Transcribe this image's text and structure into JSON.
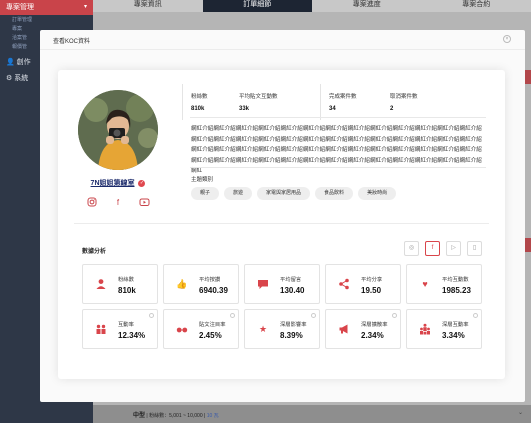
{
  "background": {
    "sidebar": {
      "menu_header": "專案管理",
      "sub_items": [
        "訂單管理",
        "專案",
        "洽案管",
        "報價管"
      ],
      "groups": [
        "創作",
        "系統"
      ]
    },
    "tabs": [
      "專案資訊",
      "訂單細節",
      "專案進度",
      "專案合約"
    ],
    "footer": {
      "label": "中型",
      "range": "| 粉絲數：5,001 ~ 10,000 |",
      "count": "10 瓦"
    }
  },
  "modal": {
    "title": "查看KOC資料",
    "profile": {
      "name": "7N姐姐第線室",
      "stats": [
        {
          "label": "粉絲數",
          "value": "810k"
        },
        {
          "label": "平均貼文互動數",
          "value": "33k"
        },
        {
          "label": "完成案件數",
          "value": "34"
        },
        {
          "label": "取消案件數",
          "value": "2"
        }
      ],
      "description": "網紅介紹網紅介紹網紅介紹網紅介紹網紅介紹網紅介紹網紅介紹網紅介紹網紅介紹網紅介紹網紅介紹網紅介紹網紅介紹網紅介紹網紅介紹網紅介紹網紅介紹網紅介紹網紅介紹網紅介紹網紅介紹網紅介紹網紅介紹網紅介紹網紅介紹網紅介紹網紅介紹網紅介紹網紅介紹網紅介紹網紅介紹網紅介紹網紅介紹網紅介紹網紅介紹網紅介紹網紅介紹網紅介紹網紅介紹網紅介紹網紅介紹網紅介紹網紅介紹網紅介紹網紅介紹網紅介紹網紅介紹網紅介紹網紅介紹網紅介紹網紅介紹網紅介紹網紅",
      "category_title": "主題類別",
      "categories": [
        "親子",
        "旅遊",
        "家電與家居用品",
        "食品飲料",
        "美妝時尚"
      ]
    },
    "analytics": {
      "title": "數據分析",
      "metrics": [
        {
          "icon": "person-icon",
          "label": "粉絲數",
          "value": "810k"
        },
        {
          "icon": "thumbs-up-icon",
          "label": "平均按讚",
          "value": "6940.39"
        },
        {
          "icon": "chat-icon",
          "label": "平均留言",
          "value": "130.40"
        },
        {
          "icon": "share-icon",
          "label": "平均分享",
          "value": "19.50"
        },
        {
          "icon": "heart-icon",
          "label": "平均互動數",
          "value": "1985.23"
        },
        {
          "icon": "people-icon",
          "label": "互動率",
          "value": "12.34%"
        },
        {
          "icon": "glasses-icon",
          "label": "貼文注目率",
          "value": "2.45%"
        },
        {
          "icon": "star-icon",
          "label": "深層影響率",
          "value": "8.39%"
        },
        {
          "icon": "megaphone-icon",
          "label": "深層擴散率",
          "value": "2.34%"
        },
        {
          "icon": "crowd-icon",
          "label": "深層互動率",
          "value": "3.34%"
        }
      ]
    }
  }
}
